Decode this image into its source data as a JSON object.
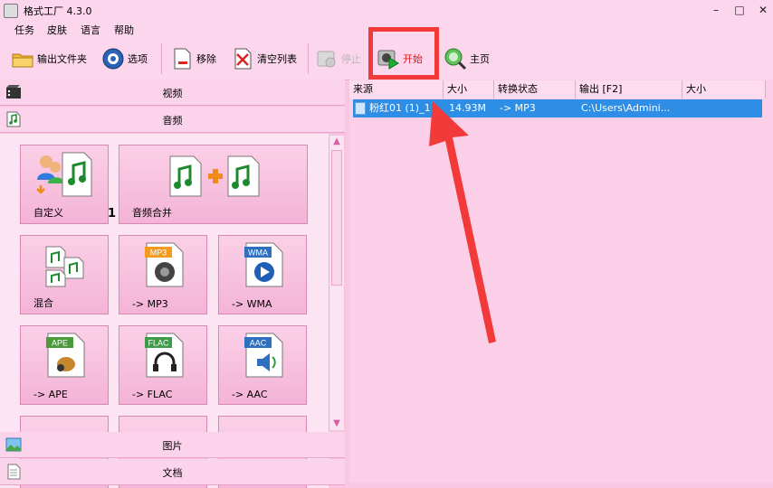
{
  "window": {
    "title": "格式工厂 4.3.0",
    "minimize": "–",
    "maximize": "□",
    "close": "✕"
  },
  "menu": [
    "任务",
    "皮肤",
    "语言",
    "帮助"
  ],
  "toolbar": {
    "output_folder": "输出文件夹",
    "options": "选项",
    "remove": "移除",
    "clear_list": "清空列表",
    "stop": "停止",
    "start": "开始",
    "home": "主页"
  },
  "categories": {
    "video": "视频",
    "audio": "音频",
    "image": "图片",
    "document": "文档"
  },
  "tiles": {
    "custom": "自定义",
    "custom_badge": "1",
    "merge": "音频合并",
    "mix": "混合",
    "mp3": "-> MP3",
    "wma": "-> WMA",
    "ape": "-> APE",
    "flac": "-> FLAC",
    "aac": "-> AAC",
    "icon_tags": {
      "mp3": "MP3",
      "wma": "WMA",
      "ape": "APE",
      "flac": "FLAC",
      "aac": "AAC"
    }
  },
  "task_table": {
    "headers": [
      "来源",
      "大小",
      "转换状态",
      "输出 [F2]",
      "大小"
    ],
    "rows": [
      {
        "source": "粉红01 (1)_1",
        "size": "14.93M",
        "status": "-> MP3",
        "output": "C:\\Users\\Admini...",
        "out_size": ""
      }
    ]
  },
  "colors": {
    "highlight": "#f33a3a",
    "selection": "#2e8ee6",
    "accent": "#f9c6e3"
  }
}
